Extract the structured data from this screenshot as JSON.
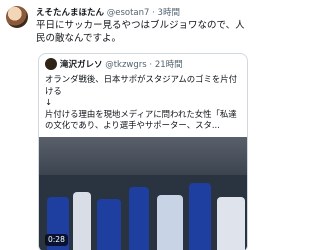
{
  "tweet": {
    "display_name": "えそたんまほたん",
    "handle": "@esotan7",
    "separator": " · ",
    "time": "3時間",
    "text": "平日にサッカー見るやつはブルジョワなので、人民の敵なんですよ。"
  },
  "quoted": {
    "display_name": "滝沢ガレソ",
    "handle": "@tkzwgrs",
    "separator": " · ",
    "time": "21時間",
    "text": "オランダ戦後、日本サポがスタジアムのゴミを片付ける\n↓\n片付ける理由を現地メディアに問われた女性「私達の文化であり、より選手やサポーター、スタ..."
  },
  "media": {
    "duration": "0:28"
  },
  "colors": {
    "text_primary": "#0f1419",
    "text_secondary": "#536471",
    "border": "#cfd9de",
    "jersey_blue": "#1f3fa0"
  }
}
